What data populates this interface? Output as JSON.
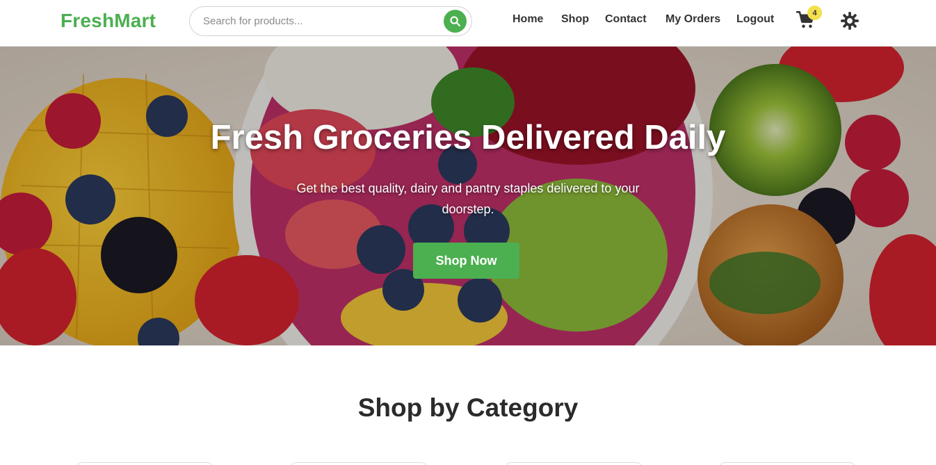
{
  "brand": {
    "name": "FreshMart",
    "color": "#4caf50"
  },
  "search": {
    "placeholder": "Search for products...",
    "value": "",
    "icon": "search-icon"
  },
  "nav": {
    "links": [
      {
        "label": "Home"
      },
      {
        "label": "Shop"
      },
      {
        "label": "Contact"
      },
      {
        "label": "My Orders"
      },
      {
        "label": "Logout"
      }
    ],
    "cart": {
      "icon": "cart-icon",
      "count": "4"
    },
    "theme_toggle": {
      "icon": "sun-icon"
    }
  },
  "hero": {
    "title": "Fresh Groceries Delivered Daily",
    "subtitle": "Get the best quality, dairy and pantry staples delivered to your doorstep.",
    "button_label": "Shop Now"
  },
  "categories": {
    "title": "Shop by Category",
    "cards_visible": 4
  },
  "colors": {
    "accent": "#4caf50",
    "badge": "#f4e04d",
    "text_dark": "#333333"
  }
}
